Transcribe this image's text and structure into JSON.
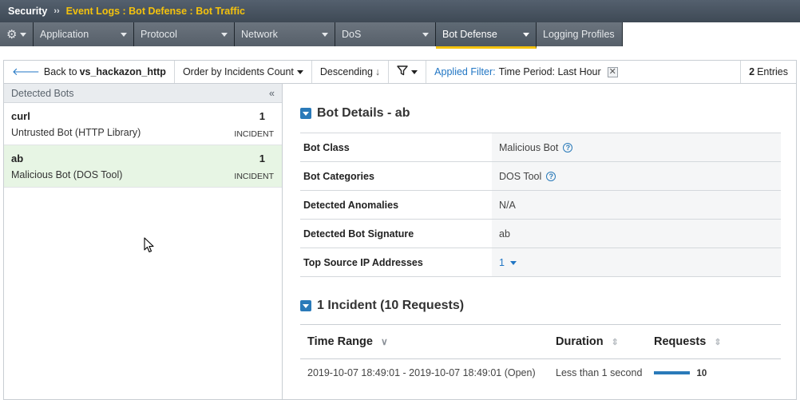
{
  "breadcrumb": {
    "root": "Security",
    "separator": "››",
    "path": "Event Logs : Bot Defense : Bot Traffic"
  },
  "tabs": [
    {
      "label": "Application",
      "active": false
    },
    {
      "label": "Protocol",
      "active": false
    },
    {
      "label": "Network",
      "active": false
    },
    {
      "label": "DoS",
      "active": false
    },
    {
      "label": "Bot Defense",
      "active": true
    },
    {
      "label": "Logging Profiles",
      "active": false
    }
  ],
  "toolbar": {
    "back_prefix": "Back to",
    "back_target": "vs_hackazon_http",
    "order_by": "Order by Incidents Count",
    "direction": "Descending",
    "filter_label": "Applied Filter:",
    "filter_value": "Time Period: Last Hour",
    "entries_count": "2",
    "entries_label": "Entries"
  },
  "detected_bots": {
    "header": "Detected Bots",
    "collapse_glyph": "«",
    "items": [
      {
        "name": "curl",
        "description": "Untrusted Bot (HTTP Library)",
        "count": "1",
        "unit": "INCIDENT",
        "selected": false
      },
      {
        "name": "ab",
        "description": "Malicious Bot (DOS Tool)",
        "count": "1",
        "unit": "INCIDENT",
        "selected": true
      }
    ]
  },
  "bot_details": {
    "title": "Bot Details - ab",
    "rows": [
      {
        "label": "Bot Class",
        "value": "Malicious Bot"
      },
      {
        "label": "Bot Categories",
        "value": "DOS Tool"
      },
      {
        "label": "Detected Anomalies",
        "value": "N/A"
      },
      {
        "label": "Detected Bot Signature",
        "value": "ab"
      },
      {
        "label": "Top Source IP Addresses",
        "value": "1"
      }
    ]
  },
  "incidents": {
    "title": "1 Incident (10 Requests)",
    "columns": [
      "Time Range",
      "Duration",
      "Requests"
    ],
    "rows": [
      {
        "time_range": "2019-10-07 18:49:01 - 2019-10-07 18:49:01 (Open)",
        "duration": "Less than 1 second",
        "requests": "10"
      }
    ]
  },
  "colors": {
    "accent": "#f4c20d",
    "link": "#2176c4",
    "selected_row": "#e7f5e4"
  }
}
